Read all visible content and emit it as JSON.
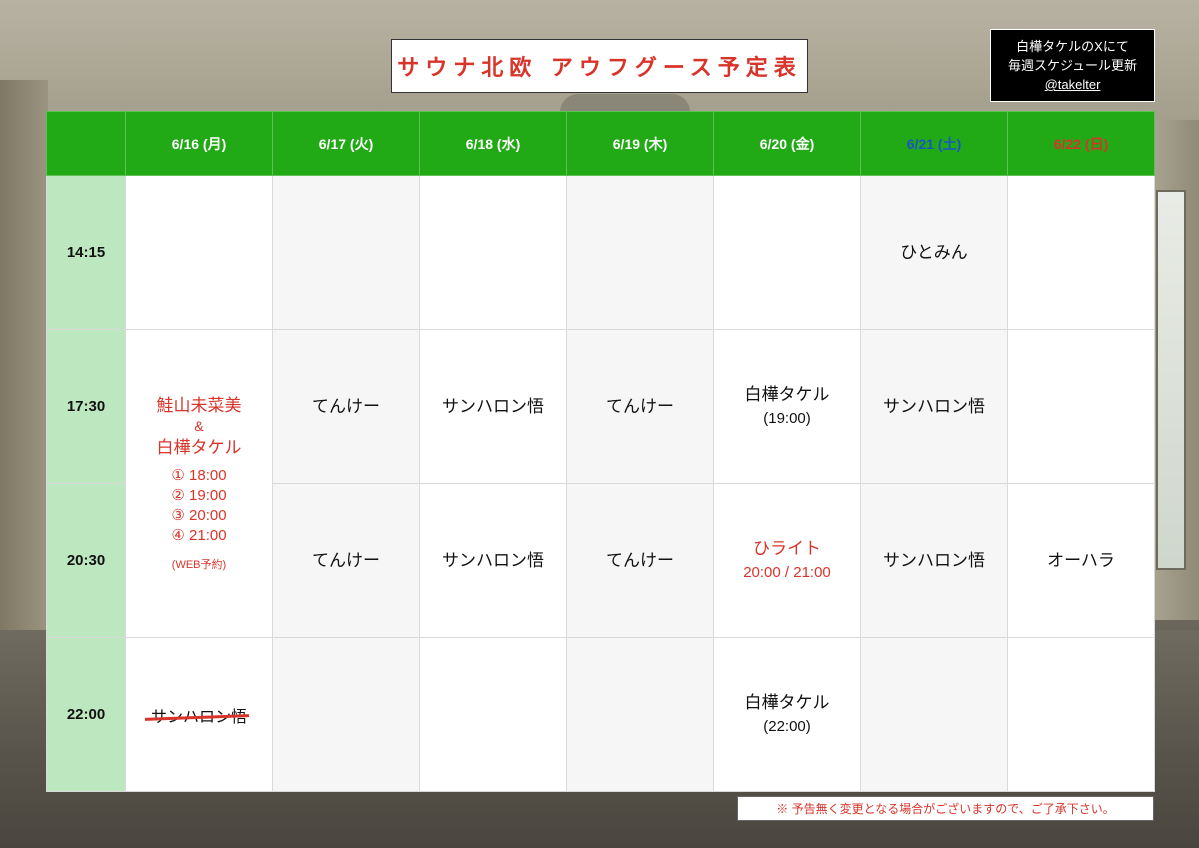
{
  "title": "サウナ北欧 アウフグース予定表",
  "info": {
    "line1": "白樺タケルのXにて",
    "line2": "毎週スケジュール更新",
    "handle": "@takelter"
  },
  "days": [
    "6/16 (月)",
    "6/17 (火)",
    "6/18 (水)",
    "6/19 (木)",
    "6/20 (金)",
    "6/21 (土)",
    "6/22 (日)"
  ],
  "times": [
    "14:15",
    "17:30",
    "20:30",
    "22:00"
  ],
  "slots": {
    "r1_sat": "ひとみん",
    "mon_special": {
      "name1": "鮭山未菜美",
      "amp": "&",
      "name2": "白樺タケル",
      "s1": "① 18:00",
      "s2": "② 19:00",
      "s3": "③ 20:00",
      "s4": "④ 21:00",
      "note": "(WEB予約)"
    },
    "r2_tue": "てんけー",
    "r2_wed": "サンハロン悟",
    "r2_thu": "てんけー",
    "r2_fri_name": "白樺タケル",
    "r2_fri_time": "(19:00)",
    "r2_sat": "サンハロン悟",
    "r3_tue": "てんけー",
    "r3_wed": "サンハロン悟",
    "r3_thu": "てんけー",
    "r3_fri_name": "ひライト",
    "r3_fri_time": "20:00 / 21:00",
    "r3_sat": "サンハロン悟",
    "r3_sun": "オーハラ",
    "r4_mon_cancelled": "サンハロン悟",
    "r4_fri_name": "白樺タケル",
    "r4_fri_time": "(22:00)"
  },
  "note": "※ 予告無く変更となる場合がございますので、ご了承下さい。",
  "colors": {
    "header_green": "#22a916",
    "time_green": "#bde8bf",
    "accent_red": "#d8342a",
    "saturday_blue": "#1a55c4"
  }
}
